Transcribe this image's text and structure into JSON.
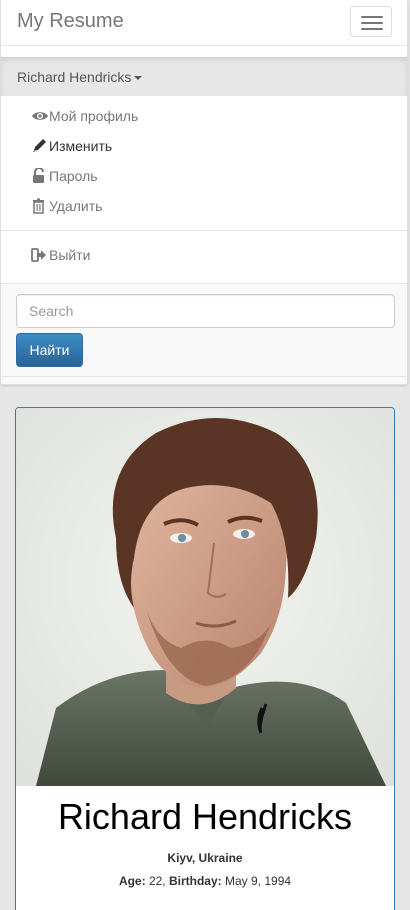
{
  "navbar": {
    "brand": "My Resume",
    "user_name": "Richard Hendricks",
    "menu": [
      {
        "label": "Мой профиль",
        "icon": "eye-icon"
      },
      {
        "label": "Изменить",
        "icon": "pencil-icon"
      },
      {
        "label": "Пароль",
        "icon": "lock-icon"
      },
      {
        "label": "Удалить",
        "icon": "trash-icon"
      },
      {
        "label": "Выйти",
        "icon": "logout-icon"
      }
    ],
    "search": {
      "placeholder": "Search",
      "value": "",
      "button_label": "Найти"
    }
  },
  "profile": {
    "name": "Richard Hendricks",
    "location": "Kiyv, Ukraine",
    "age_label": "Age:",
    "age": "22,",
    "birthday_label": "Birthday:",
    "birthday": "May 9, 1994"
  },
  "colors": {
    "accent": "#337ab7",
    "button": "#2a6496",
    "navbar_bg": "#f8f8f8",
    "page_bg": "#e6e6e6"
  }
}
